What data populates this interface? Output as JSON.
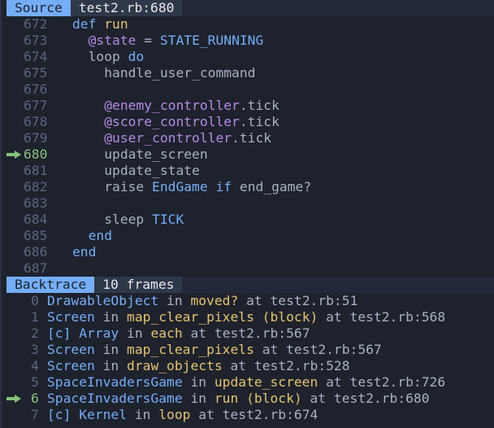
{
  "source": {
    "title": "Source",
    "location": "test2.rb:680",
    "current_line": 680,
    "lines": [
      {
        "no": "672",
        "indent": 0,
        "tokens": [
          {
            "t": "kw",
            "v": "def"
          },
          {
            "t": "plain",
            "v": " "
          },
          {
            "t": "fn",
            "v": "run"
          }
        ]
      },
      {
        "no": "673",
        "indent": 1,
        "tokens": [
          {
            "t": "ivar",
            "v": "@state"
          },
          {
            "t": "plain",
            "v": " = "
          },
          {
            "t": "const",
            "v": "STATE_RUNNING"
          }
        ]
      },
      {
        "no": "674",
        "indent": 1,
        "tokens": [
          {
            "t": "plain",
            "v": "loop "
          },
          {
            "t": "kw",
            "v": "do"
          }
        ]
      },
      {
        "no": "675",
        "indent": 2,
        "tokens": [
          {
            "t": "plain",
            "v": "handle_user_command"
          }
        ]
      },
      {
        "no": "676",
        "indent": 0,
        "tokens": []
      },
      {
        "no": "677",
        "indent": 2,
        "tokens": [
          {
            "t": "ivar",
            "v": "@enemy_controller"
          },
          {
            "t": "plain",
            "v": ".tick"
          }
        ]
      },
      {
        "no": "678",
        "indent": 2,
        "tokens": [
          {
            "t": "ivar",
            "v": "@score_controller"
          },
          {
            "t": "plain",
            "v": ".tick"
          }
        ]
      },
      {
        "no": "679",
        "indent": 2,
        "tokens": [
          {
            "t": "ivar",
            "v": "@user_controller"
          },
          {
            "t": "plain",
            "v": ".tick"
          }
        ]
      },
      {
        "no": "680",
        "indent": 2,
        "current": true,
        "tokens": [
          {
            "t": "plain",
            "v": "update_screen"
          }
        ]
      },
      {
        "no": "681",
        "indent": 2,
        "tokens": [
          {
            "t": "plain",
            "v": "update_state"
          }
        ]
      },
      {
        "no": "682",
        "indent": 2,
        "tokens": [
          {
            "t": "plain",
            "v": "raise "
          },
          {
            "t": "const",
            "v": "EndGame"
          },
          {
            "t": "plain",
            "v": " "
          },
          {
            "t": "kw",
            "v": "if"
          },
          {
            "t": "plain",
            "v": " end_game?"
          }
        ]
      },
      {
        "no": "683",
        "indent": 0,
        "tokens": []
      },
      {
        "no": "684",
        "indent": 2,
        "tokens": [
          {
            "t": "plain",
            "v": "sleep "
          },
          {
            "t": "const",
            "v": "TICK"
          }
        ]
      },
      {
        "no": "685",
        "indent": 1,
        "tokens": [
          {
            "t": "kw",
            "v": "end"
          }
        ]
      },
      {
        "no": "686",
        "indent": 0,
        "tokens": [
          {
            "t": "kw",
            "v": "end"
          }
        ]
      },
      {
        "no": "687",
        "indent": 0,
        "tokens": []
      }
    ]
  },
  "backtrace": {
    "title": "Backtrace",
    "info": "10 frames",
    "frames": [
      {
        "index": "0",
        "cls": "DrawableObject",
        "method": "moved?",
        "location": "test2.rb:51"
      },
      {
        "index": "1",
        "cls": "Screen",
        "method": "map_clear_pixels (block)",
        "location": "test2.rb:568"
      },
      {
        "index": "2",
        "cls": "[c] Array",
        "method": "each",
        "location": "test2.rb:567"
      },
      {
        "index": "3",
        "cls": "Screen",
        "method": "map_clear_pixels",
        "location": "test2.rb:567"
      },
      {
        "index": "4",
        "cls": "Screen",
        "method": "draw_objects",
        "location": "test2.rb:528"
      },
      {
        "index": "5",
        "cls": "SpaceInvadersGame",
        "method": "update_screen",
        "location": "test2.rb:726"
      },
      {
        "index": "6",
        "cls": "SpaceInvadersGame",
        "method": "run (block)",
        "location": "test2.rb:680",
        "current": true
      },
      {
        "index": "7",
        "cls": "[c] Kernel",
        "method": "loop",
        "location": "test2.rb:674"
      }
    ],
    "in_word": " in ",
    "at_word": " at "
  },
  "icons": {
    "current_marker": "arrow-right-icon"
  },
  "colors": {
    "background": "#1e222d",
    "header_bar": "#232838",
    "title_tab": "#74aef7",
    "info_tab": "#2f3849",
    "keyword": "#74aef7",
    "function": "#e6c370",
    "ivar": "#b48ae6",
    "line_number": "#5d6679",
    "current_marker": "#85c37a",
    "text": "#a9b1c0"
  }
}
